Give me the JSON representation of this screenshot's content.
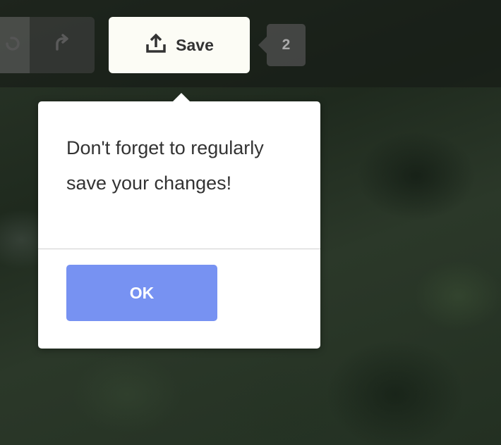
{
  "toolbar": {
    "undo_icon": "undo-icon",
    "redo_icon": "redo-icon",
    "save_icon": "upload-icon",
    "save_label": "Save",
    "edit_count": "2"
  },
  "popover": {
    "message": "Don't forget to regularly save your changes!",
    "ok_label": "OK"
  },
  "colors": {
    "save_button_bg": "#fcfcf5",
    "ok_button_bg": "#7792f2",
    "popover_bg": "#ffffff"
  }
}
